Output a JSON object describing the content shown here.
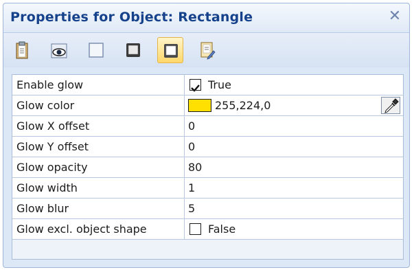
{
  "window": {
    "title": "Properties for Object: Rectangle",
    "close_glyph": "✕"
  },
  "toolbar": {
    "buttons": [
      {
        "name": "clipboard-icon",
        "active": false
      },
      {
        "name": "eye-icon",
        "active": false
      },
      {
        "name": "fill-icon",
        "active": false
      },
      {
        "name": "shadow-icon",
        "active": false
      },
      {
        "name": "glow-icon",
        "active": true
      },
      {
        "name": "edit-document-icon",
        "active": false
      }
    ]
  },
  "properties": {
    "enable_glow": {
      "label": "Enable glow",
      "value": "True",
      "checked": true
    },
    "glow_color": {
      "label": "Glow color",
      "value": "255,224,0",
      "swatch_color": "#ffe000"
    },
    "glow_x_offset": {
      "label": "Glow X offset",
      "value": "0"
    },
    "glow_y_offset": {
      "label": "Glow Y offset",
      "value": "0"
    },
    "glow_opacity": {
      "label": "Glow opacity",
      "value": "80"
    },
    "glow_width": {
      "label": "Glow width",
      "value": "1"
    },
    "glow_blur": {
      "label": "Glow blur",
      "value": "5"
    },
    "glow_excl_shape": {
      "label": "Glow excl. object shape",
      "value": "False",
      "checked": false
    }
  },
  "colors": {
    "title": "#15428b",
    "panel_bg": "#dde8f6",
    "active_tab": "#ffd76a"
  }
}
